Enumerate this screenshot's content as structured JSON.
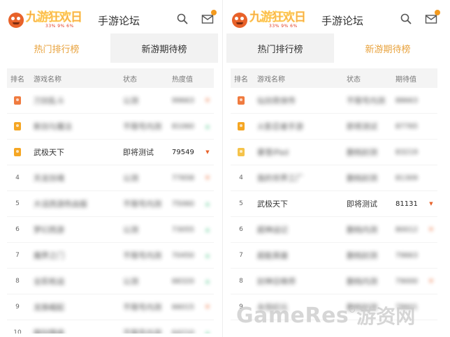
{
  "header": {
    "logo_text": "九游狂欢日",
    "logo_sub": "33% 9% 6%",
    "forum_title": "手游论坛"
  },
  "left": {
    "tabs": [
      "热门排行榜",
      "新游期待榜"
    ],
    "active_tab": 0,
    "columns": [
      "排名",
      "游戏名称",
      "状态",
      "热度值"
    ],
    "rows": [
      {
        "rank": "1",
        "medal": "#f07b3f",
        "name": "刀剑乱斗",
        "status": "公测",
        "value": "99663",
        "trend": "down",
        "blurred": true
      },
      {
        "rank": "2",
        "medal": "#f5a623",
        "name": "新剑与魔法",
        "status": "不限号内测",
        "value": "81060",
        "trend": "up",
        "blurred": true
      },
      {
        "rank": "3",
        "medal": "#f5a623",
        "name": "武极天下",
        "status": "即将测试",
        "value": "79549",
        "trend": "down",
        "blurred": false
      },
      {
        "rank": "4",
        "medal": "",
        "name": "天龙剑魂",
        "status": "公测",
        "value": "77658",
        "trend": "down",
        "blurred": true
      },
      {
        "rank": "5",
        "medal": "",
        "name": "大话西游热血版",
        "status": "不限号内测",
        "value": "75060",
        "trend": "up",
        "blurred": true
      },
      {
        "rank": "6",
        "medal": "",
        "name": "梦幻西游",
        "status": "公测",
        "value": "73055",
        "trend": "up",
        "blurred": true
      },
      {
        "rank": "7",
        "medal": "",
        "name": "魔界之门",
        "status": "不限号内测",
        "value": "70450",
        "trend": "up",
        "blurred": true
      },
      {
        "rank": "8",
        "medal": "",
        "name": "全民枪战",
        "status": "公测",
        "value": "68320",
        "trend": "up",
        "blurred": true
      },
      {
        "rank": "9",
        "medal": "",
        "name": "龙族崛起",
        "status": "不限号内测",
        "value": "66015",
        "trend": "down",
        "blurred": true
      },
      {
        "rank": "10",
        "medal": "",
        "name": "御剑情缘",
        "status": "不限号内测",
        "value": "64210",
        "trend": "up",
        "blurred": true
      }
    ]
  },
  "right": {
    "tabs": [
      "热门排行榜",
      "新游期待榜"
    ],
    "active_tab": 1,
    "columns": [
      "排名",
      "游戏名称",
      "状态",
      "期待值"
    ],
    "rows": [
      {
        "rank": "1",
        "medal": "#f07b3f",
        "name": "仙剑奇侠传",
        "status": "不限号内测",
        "value": "88663",
        "trend": "",
        "blurred": true
      },
      {
        "rank": "2",
        "medal": "#f5a623",
        "name": "火影忍者手游",
        "status": "即将测试",
        "value": "87765",
        "trend": "",
        "blurred": true
      },
      {
        "rank": "3",
        "medal": "#f5c34a",
        "name": "暴雪iPad",
        "status": "删档封测",
        "value": "83219",
        "trend": "",
        "blurred": true
      },
      {
        "rank": "4",
        "medal": "",
        "name": "我的世界工厂",
        "status": "删档封测",
        "value": "81309",
        "trend": "",
        "blurred": true
      },
      {
        "rank": "5",
        "medal": "",
        "name": "武极天下",
        "status": "即将测试",
        "value": "81131",
        "trend": "down",
        "blurred": false
      },
      {
        "rank": "6",
        "medal": "",
        "name": "超神战记",
        "status": "删档内测",
        "value": "80012",
        "trend": "down",
        "blurred": true
      },
      {
        "rank": "7",
        "medal": "",
        "name": "超能英雄",
        "status": "删档封测",
        "value": "79663",
        "trend": "",
        "blurred": true
      },
      {
        "rank": "8",
        "medal": "",
        "name": "封神召唤师",
        "status": "删档内测",
        "value": "79000",
        "trend": "down",
        "blurred": true
      },
      {
        "rank": "9",
        "medal": "",
        "name": "永恒纪元",
        "status": "删档封测",
        "value": "78601",
        "trend": "",
        "blurred": true
      }
    ]
  },
  "watermark": {
    "latin": "GameRes",
    "badge": "",
    "cn": "游资网"
  },
  "colors": {
    "accent": "#e8a23c",
    "up": "#3fbf7f",
    "down": "#e8622a"
  }
}
